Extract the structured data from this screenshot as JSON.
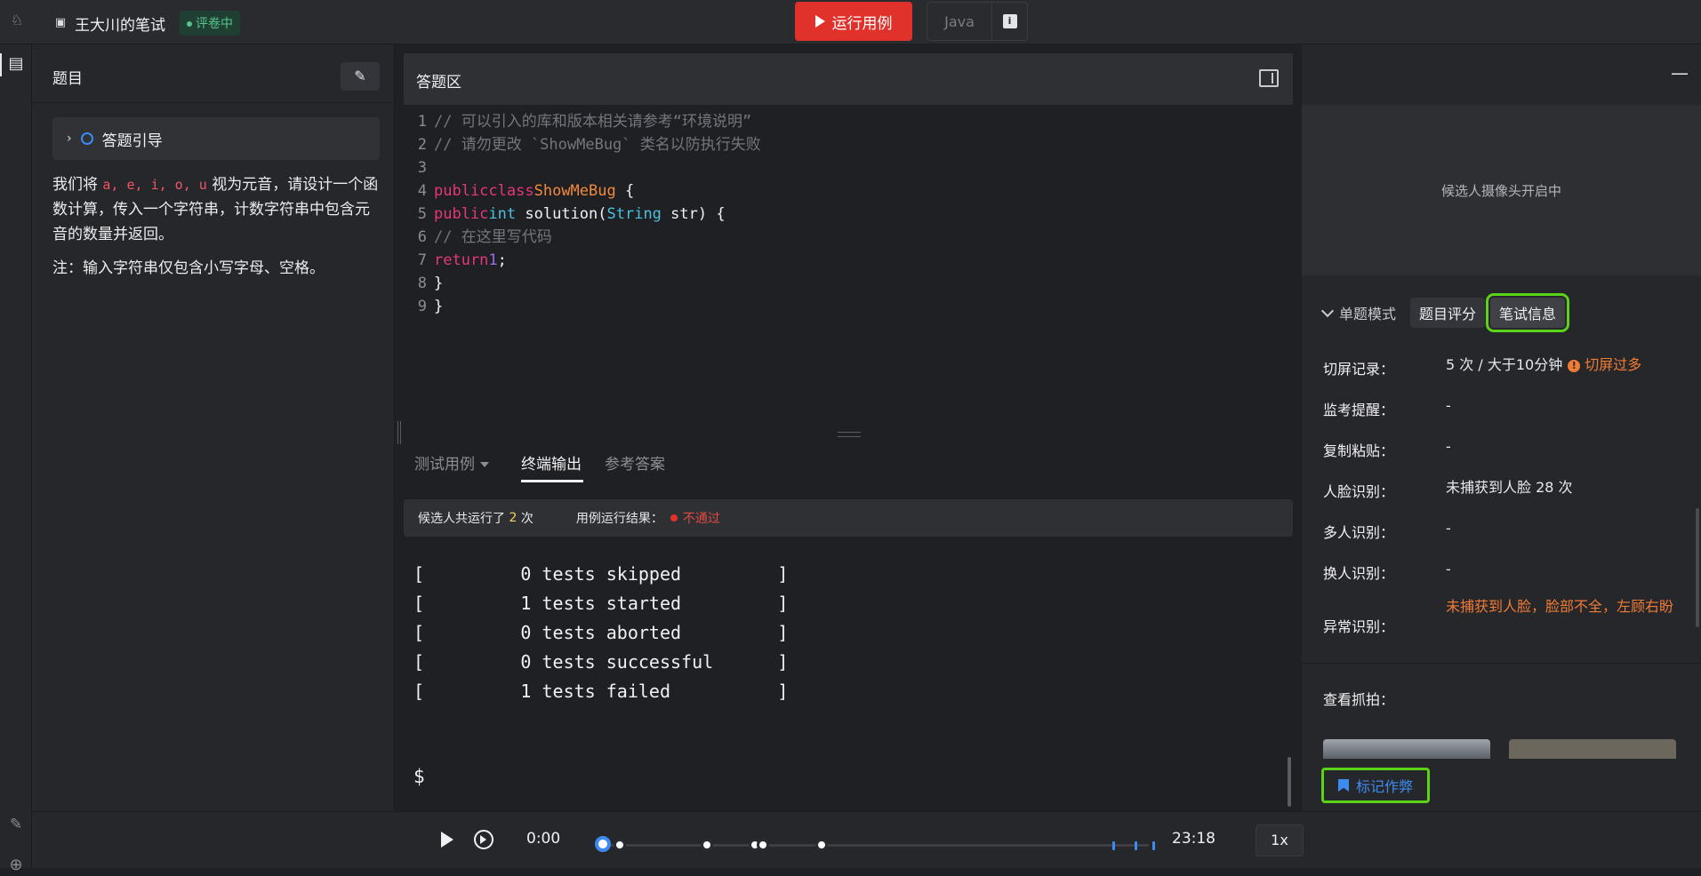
{
  "header": {
    "title": "王大川的笔试",
    "status": "评卷中",
    "run_button": "运行用例",
    "language": "Java",
    "info_icon": "info-icon"
  },
  "question": {
    "panel_title": "题目",
    "guide_label": "答题引导",
    "body_before": "我们将",
    "vowels": "a, e, i, o, u",
    "body_after": "视为元音，请设计一个函数计算，传入一个字符串，计数字符串中包含元音的数量并返回。",
    "note": "注：输入字符串仅包含小写字母、空格。"
  },
  "editor": {
    "title": "答题区",
    "line_numbers": [
      "1",
      "2",
      "3",
      "4",
      "5",
      "6",
      "7",
      "8",
      "9"
    ],
    "comment1": "// 可以引入的库和版本相关请参考“环境说明”",
    "comment2": "// 请勿更改 `ShowMeBug` 类名以防执行失败",
    "kw_public": "public",
    "kw_class": "class",
    "class_name": "ShowMeBug",
    "brace_open": " {",
    "kw_int": "int",
    "method": " solution(",
    "type_string": "String",
    "param": " str) {",
    "comment3": "// 在这里写代码",
    "kw_return": "return",
    "ret_val": "1",
    "semicolon": ";",
    "close_inner": "}",
    "close_outer": "}"
  },
  "output": {
    "tabs": [
      "测试用例",
      "终端输出",
      "参考答案"
    ],
    "run_count_prefix": "候选人共运行了",
    "run_count": "2",
    "run_count_suffix": "次",
    "result_label": "用例运行结果：",
    "result_value": "不通过",
    "terminal_lines": [
      "[         0 tests skipped         ]",
      "[         1 tests started         ]",
      "[         0 tests aborted         ]",
      "[         0 tests successful      ]",
      "[         1 tests failed          ]"
    ],
    "prompt": "$"
  },
  "monitor": {
    "minimize": "—",
    "camera_text": "候选人摄像头开启中",
    "mode_label": "单题模式",
    "tab_score": "题目评分",
    "tab_info": "笔试信息",
    "rows": [
      {
        "key": "切屏记录：",
        "value": "5 次 / 大于10分钟",
        "tag": "切屏过多"
      },
      {
        "key": "监考提醒：",
        "value": "-"
      },
      {
        "key": "复制粘贴：",
        "value": "-"
      },
      {
        "key": "人脸识别：",
        "value": "未捕获到人脸 28 次"
      },
      {
        "key": "多人识别：",
        "value": "-"
      },
      {
        "key": "换人识别：",
        "value": "-"
      },
      {
        "key": "异常识别：",
        "value": "未捕获到人脸，脸部不全，左顾右盼"
      }
    ],
    "snapshots_label": "查看抓拍：",
    "mark_button": "标记作弊"
  },
  "player": {
    "current_time": "0:00",
    "total_time": "23:18",
    "speed": "1x",
    "progress": 0
  },
  "colors": {
    "accent_red": "#e0322a",
    "accent_blue": "#3d8bf2",
    "highlight_green": "#5bd318",
    "warn_orange": "#f17b34"
  }
}
